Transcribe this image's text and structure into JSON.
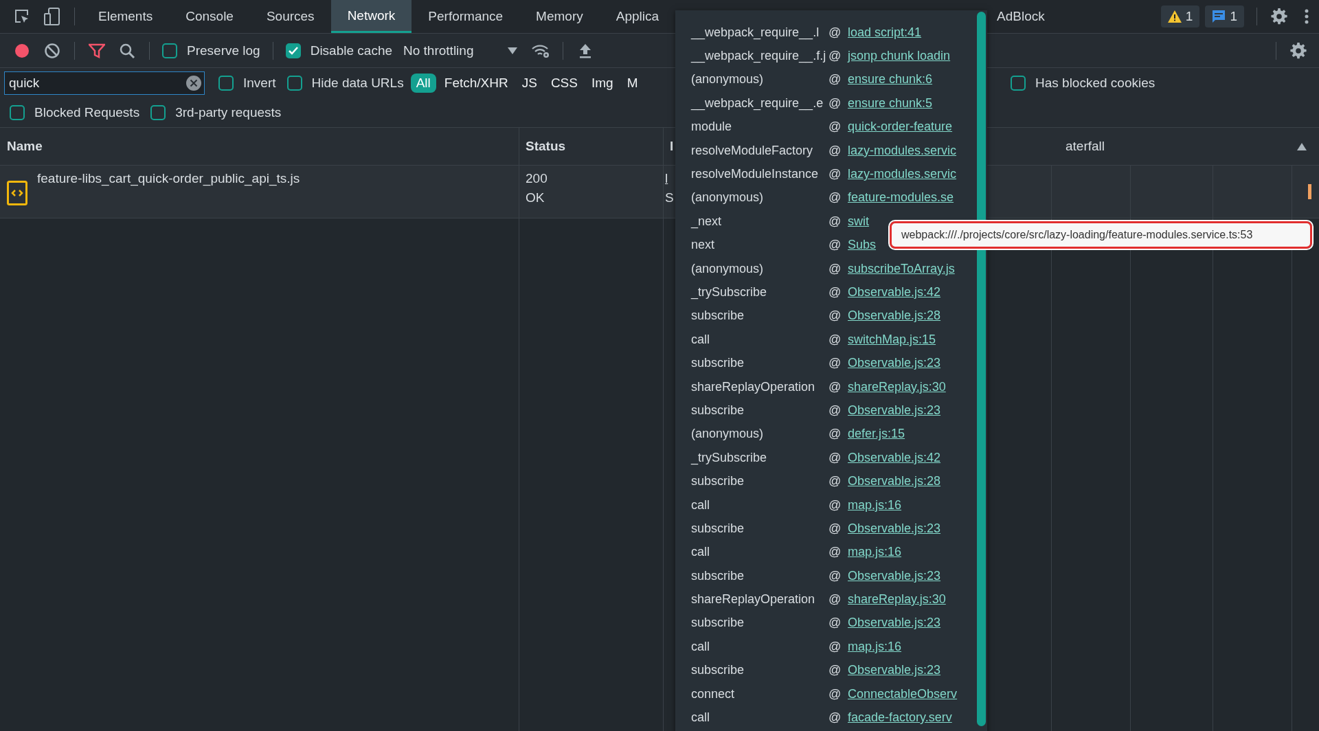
{
  "tabs": [
    {
      "label": "Elements",
      "selected": false
    },
    {
      "label": "Console",
      "selected": false
    },
    {
      "label": "Sources",
      "selected": false
    },
    {
      "label": "Network",
      "selected": true
    },
    {
      "label": "Performance",
      "selected": false
    },
    {
      "label": "Memory",
      "selected": false
    },
    {
      "label": "Applica",
      "selected": false
    }
  ],
  "extension_tab": {
    "label": "AdBlock"
  },
  "badges": [
    {
      "kind": "warning",
      "count": "1"
    },
    {
      "kind": "message",
      "count": "1"
    }
  ],
  "toolbar": {
    "recording": true,
    "preserve_log": {
      "label": "Preserve log",
      "checked": false
    },
    "disable_cache": {
      "label": "Disable cache",
      "checked": true
    },
    "throttling": "No throttling"
  },
  "filter": {
    "value": "quick",
    "invert": {
      "label": "Invert",
      "checked": false
    },
    "hide_data_urls": {
      "label": "Hide data URLs",
      "checked": false
    },
    "types": [
      {
        "label": "All",
        "selected": true
      },
      {
        "label": "Fetch/XHR",
        "selected": false
      },
      {
        "label": "JS",
        "selected": false
      },
      {
        "label": "CSS",
        "selected": false
      },
      {
        "label": "Img",
        "selected": false
      },
      {
        "label": "M",
        "selected": false
      }
    ],
    "has_blocked_cookies": {
      "label": "Has blocked cookies",
      "checked": false
    },
    "blocked_requests": {
      "label": "Blocked Requests",
      "checked": false
    },
    "third_party": {
      "label": "3rd-party requests",
      "checked": false
    }
  },
  "table": {
    "columns": [
      "Name",
      "Status",
      "I",
      "aterfall"
    ],
    "rows": [
      {
        "name": "feature-libs_cart_quick-order_public_api_ts.js",
        "status": "200",
        "status_text": "OK",
        "column_3": "l",
        "column_3_sub": "S"
      }
    ]
  },
  "call_stack": [
    {
      "function": "__webpack_require__.l",
      "separator": "@",
      "location": "load script:41"
    },
    {
      "function": "__webpack_require__.f.j",
      "separator": "@",
      "location": "jsonp chunk loadin"
    },
    {
      "function": "(anonymous)",
      "separator": "@",
      "location": "ensure chunk:6"
    },
    {
      "function": "__webpack_require__.e",
      "separator": "@",
      "location": "ensure chunk:5"
    },
    {
      "function": "module",
      "separator": "@",
      "location": "quick-order-feature"
    },
    {
      "function": "resolveModuleFactory",
      "separator": "@",
      "location": "lazy-modules.servic"
    },
    {
      "function": "resolveModuleInstance",
      "separator": "@",
      "location": "lazy-modules.servic"
    },
    {
      "function": "(anonymous)",
      "separator": "@",
      "location": "feature-modules.se"
    },
    {
      "function": "_next",
      "separator": "@",
      "location": "swit"
    },
    {
      "function": "next",
      "separator": "@",
      "location": "Subs"
    },
    {
      "function": "(anonymous)",
      "separator": "@",
      "location": "subscribeToArray.js"
    },
    {
      "function": "_trySubscribe",
      "separator": "@",
      "location": "Observable.js:42"
    },
    {
      "function": "subscribe",
      "separator": "@",
      "location": "Observable.js:28"
    },
    {
      "function": "call",
      "separator": "@",
      "location": "switchMap.js:15"
    },
    {
      "function": "subscribe",
      "separator": "@",
      "location": "Observable.js:23"
    },
    {
      "function": "shareReplayOperation",
      "separator": "@",
      "location": "shareReplay.js:30"
    },
    {
      "function": "subscribe",
      "separator": "@",
      "location": "Observable.js:23"
    },
    {
      "function": "(anonymous)",
      "separator": "@",
      "location": "defer.js:15"
    },
    {
      "function": "_trySubscribe",
      "separator": "@",
      "location": "Observable.js:42"
    },
    {
      "function": "subscribe",
      "separator": "@",
      "location": "Observable.js:28"
    },
    {
      "function": "call",
      "separator": "@",
      "location": "map.js:16"
    },
    {
      "function": "subscribe",
      "separator": "@",
      "location": "Observable.js:23"
    },
    {
      "function": "call",
      "separator": "@",
      "location": "map.js:16"
    },
    {
      "function": "subscribe",
      "separator": "@",
      "location": "Observable.js:23"
    },
    {
      "function": "shareReplayOperation",
      "separator": "@",
      "location": "shareReplay.js:30"
    },
    {
      "function": "subscribe",
      "separator": "@",
      "location": "Observable.js:23"
    },
    {
      "function": "call",
      "separator": "@",
      "location": "map.js:16"
    },
    {
      "function": "subscribe",
      "separator": "@",
      "location": "Observable.js:23"
    },
    {
      "function": "connect",
      "separator": "@",
      "location": "ConnectableObserv"
    },
    {
      "function": "call",
      "separator": "@",
      "location": "facade-factory.serv"
    }
  ],
  "tooltip": "webpack:///./projects/core/src/lazy-loading/feature-modules.service.ts:53"
}
